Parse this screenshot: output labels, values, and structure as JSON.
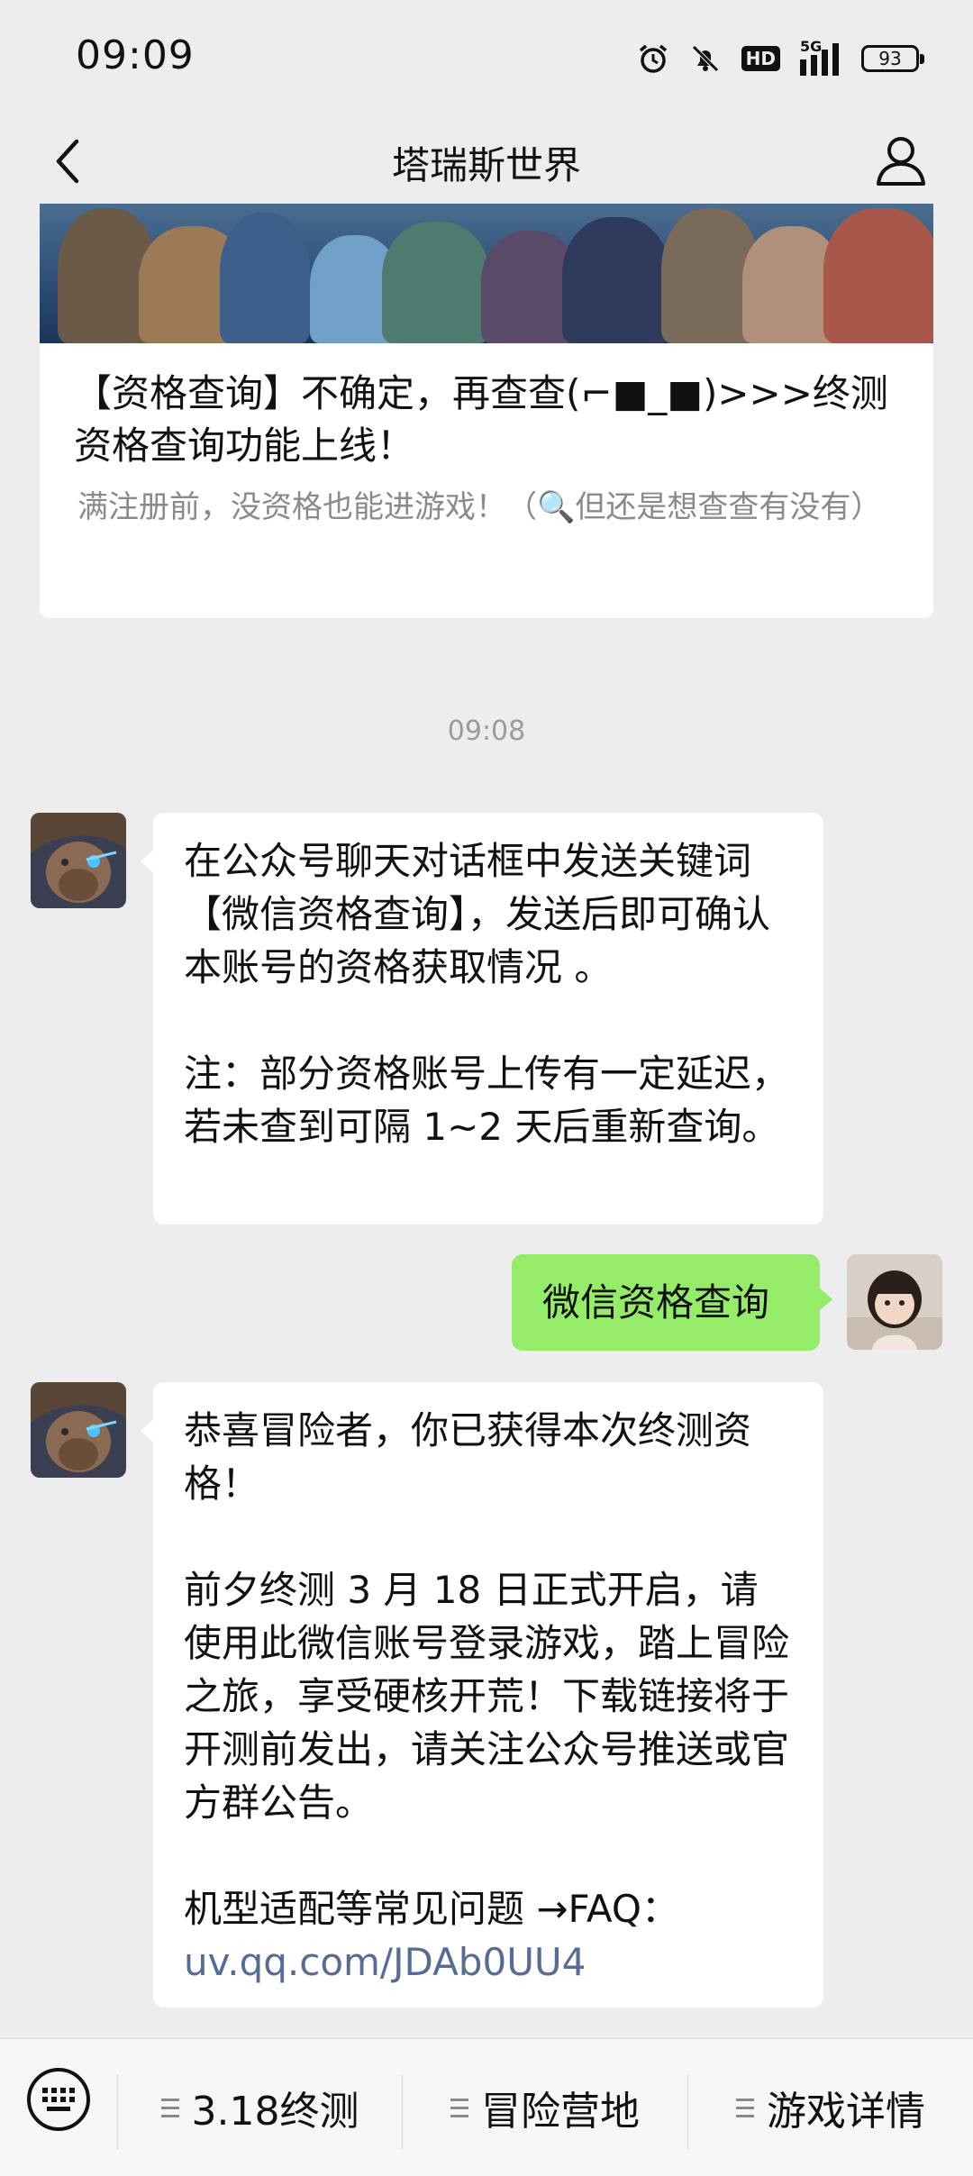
{
  "status_bar": {
    "time": "09:09",
    "network": "5G",
    "hd_label": "HD",
    "battery": "93",
    "icons": [
      "alarm-icon",
      "mute-icon",
      "hd-icon",
      "signal-icon",
      "battery-icon"
    ]
  },
  "nav": {
    "title": "塔瑞斯世界",
    "back_icon": "chevron-left-icon",
    "profile_icon": "person-icon"
  },
  "article": {
    "title": "【资格查询】不确定，再查查(⌐■_■)>>>终测资格查询功能上线！",
    "description": "满注册前，没资格也能进游戏！（🔍但还是想查查有没有）"
  },
  "timestamp": "09:08",
  "messages": [
    {
      "sender": "official-account",
      "text": "在公众号聊天对话框中发送关键词【微信资格查询】，发送后即可确认本账号的资格获取情况 。\n\n注：部分资格账号上传有一定延迟，若未查到可隔 1~2 天后重新查询。"
    },
    {
      "sender": "me",
      "text": "微信资格查询"
    },
    {
      "sender": "official-account",
      "text_main": "恭喜冒险者，你已获得本次终测资格！\n\n前夕终测 3 月 18 日正式开启，请使用此微信账号登录游戏，踏上冒险之旅，享受硬核开荒！下载链接将于开测前发出，请关注公众号推送或官方群公告。\n\n机型适配等常见问题 →FAQ：",
      "link": "uv.qq.com/JDAb0UU4"
    }
  ],
  "bottom_menu": {
    "keyboard_icon": "keyboard-icon",
    "items": [
      "3.18终测",
      "冒险营地",
      "游戏详情"
    ]
  },
  "colors": {
    "background": "#ededed",
    "outgoing_bubble": "#95ec69",
    "incoming_bubble": "#ffffff",
    "link": "#576b95"
  }
}
